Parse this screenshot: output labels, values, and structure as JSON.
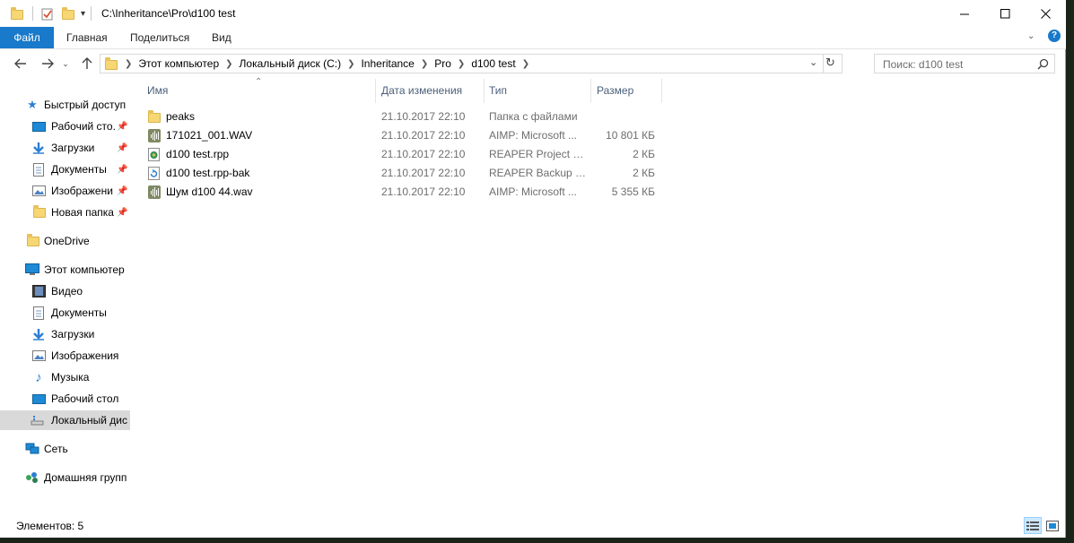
{
  "window": {
    "title": "C:\\Inheritance\\Pro\\d100 test"
  },
  "ribbon": {
    "tabs": [
      "Файл",
      "Главная",
      "Поделиться",
      "Вид"
    ]
  },
  "address": {
    "breadcrumbs": [
      "Этот компьютер",
      "Локальный диск (C:)",
      "Inheritance",
      "Pro",
      "d100 test"
    ]
  },
  "search": {
    "placeholder": "Поиск: d100 test"
  },
  "sidebar": {
    "items": [
      {
        "label": "Быстрый доступ",
        "icon": "star-icon"
      },
      {
        "label": "Рабочий сто.",
        "icon": "desktop-icon",
        "pinned": true
      },
      {
        "label": "Загрузки",
        "icon": "download-icon",
        "pinned": true
      },
      {
        "label": "Документы",
        "icon": "documents-icon",
        "pinned": true
      },
      {
        "label": "Изображени",
        "icon": "pictures-icon",
        "pinned": true
      },
      {
        "label": "Новая папка",
        "icon": "folder-icon",
        "pinned": true
      },
      {
        "label": "OneDrive",
        "icon": "folder-icon"
      },
      {
        "label": "Этот компьютер",
        "icon": "computer-icon"
      },
      {
        "label": "Видео",
        "icon": "video-icon"
      },
      {
        "label": "Документы",
        "icon": "documents-icon"
      },
      {
        "label": "Загрузки",
        "icon": "download-icon"
      },
      {
        "label": "Изображения",
        "icon": "pictures-icon"
      },
      {
        "label": "Музыка",
        "icon": "music-icon"
      },
      {
        "label": "Рабочий стол",
        "icon": "desktop-icon"
      },
      {
        "label": "Локальный дис",
        "icon": "drive-icon",
        "selected": true
      },
      {
        "label": "Сеть",
        "icon": "network-icon"
      },
      {
        "label": "Домашняя групп",
        "icon": "homegroup-icon"
      }
    ]
  },
  "columns": {
    "name": "Имя",
    "date": "Дата изменения",
    "type": "Тип",
    "size": "Размер"
  },
  "files": [
    {
      "name": "peaks",
      "date": "21.10.2017 22:10",
      "type": "Папка с файлами",
      "size": "",
      "icon": "folder-icon"
    },
    {
      "name": "171021_001.WAV",
      "date": "21.10.2017 22:10",
      "type": "AIMP: Microsoft ...",
      "size": "10 801 КБ",
      "icon": "audio-file-icon"
    },
    {
      "name": "d100 test.rpp",
      "date": "21.10.2017 22:10",
      "type": "REAPER Project File",
      "size": "2 КБ",
      "icon": "reaper-project-icon"
    },
    {
      "name": "d100 test.rpp-bak",
      "date": "21.10.2017 22:10",
      "type": "REAPER Backup Pr...",
      "size": "2 КБ",
      "icon": "reaper-backup-icon"
    },
    {
      "name": "Шум d100 44.wav",
      "date": "21.10.2017 22:10",
      "type": "AIMP: Microsoft ...",
      "size": "5 355 КБ",
      "icon": "audio-file-icon"
    }
  ],
  "status": {
    "count_text": "Элементов: 5"
  },
  "colors": {
    "file_tab": "#1979ca",
    "selected_nav": "#d9d9d9",
    "header_text": "#4c607a"
  }
}
